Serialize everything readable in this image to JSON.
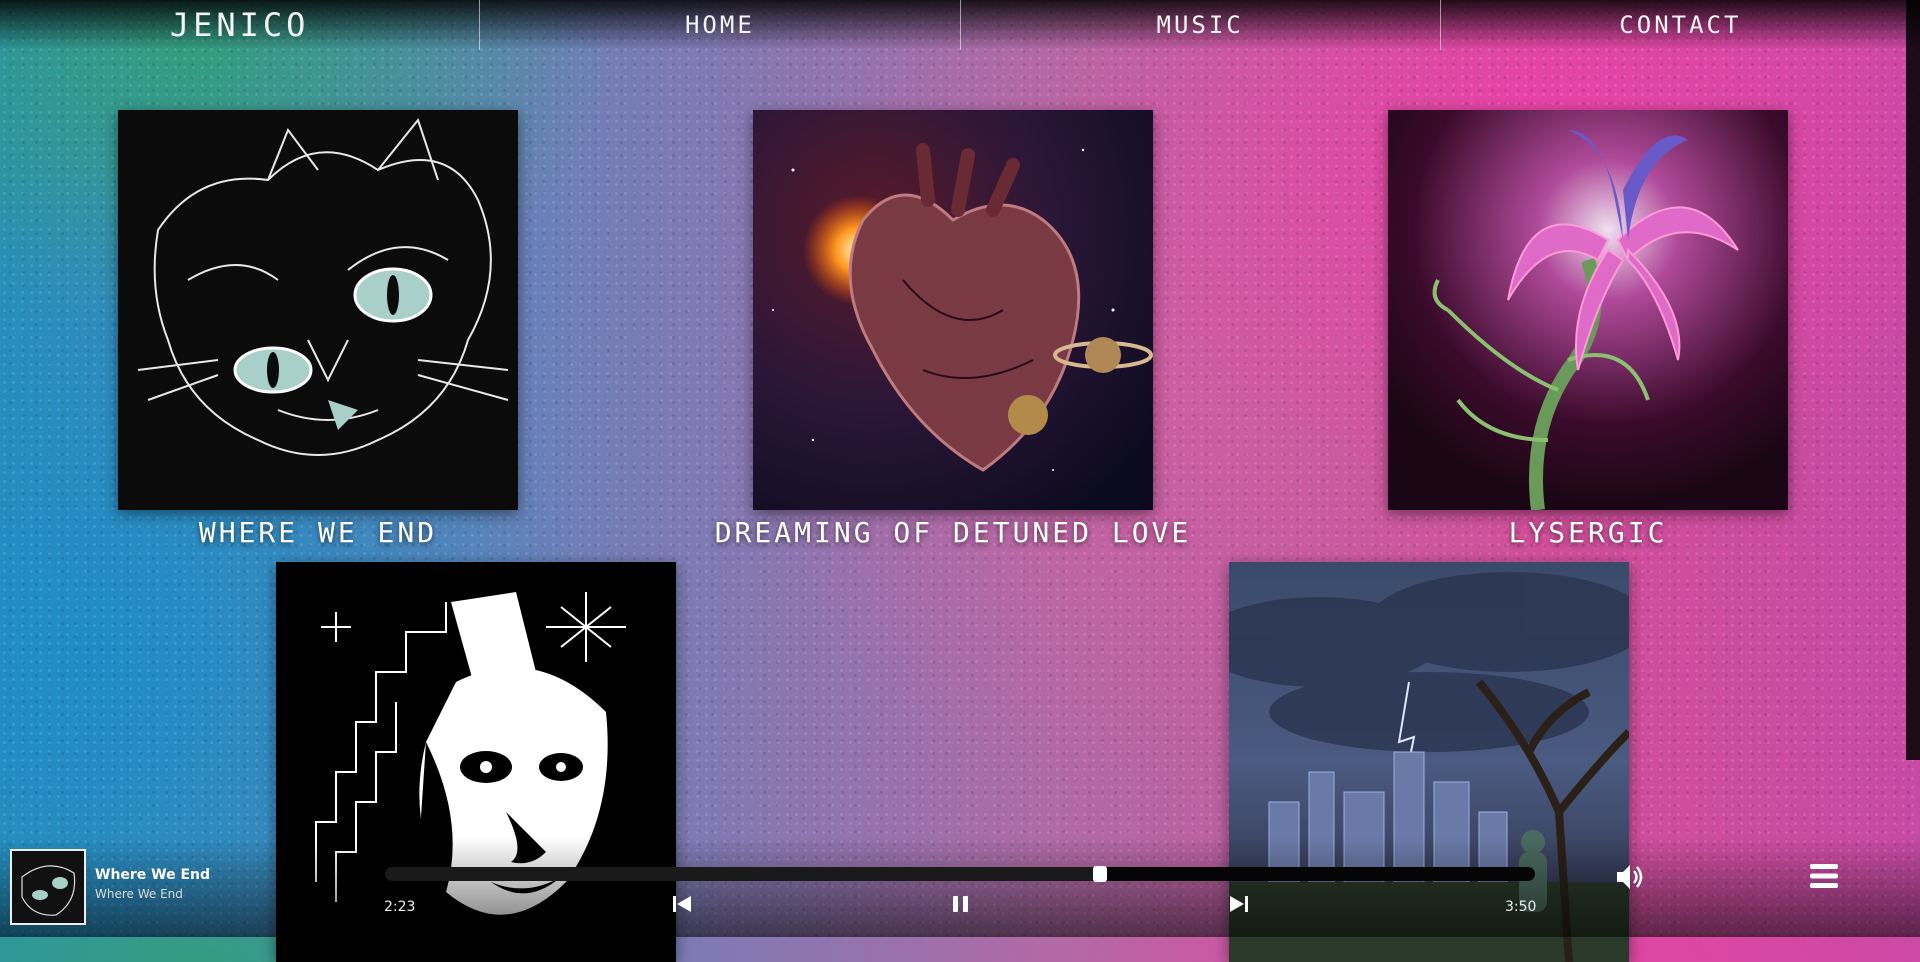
{
  "nav": {
    "brand": "JENICO",
    "items": [
      "HOME",
      "MUSIC",
      "CONTACT"
    ]
  },
  "albums": [
    {
      "title": "WHERE WE END"
    },
    {
      "title": "DREAMING OF DETUNED LOVE"
    },
    {
      "title": "LYSERGIC"
    },
    {
      "title": ""
    },
    {
      "title": ""
    }
  ],
  "player": {
    "track_title": "Where We End",
    "artist": "Where We End",
    "current_time": "2:23",
    "total_time": "3:50",
    "progress": 0.622
  },
  "colors": {
    "accent_pink": "#d24f9a",
    "accent_teal": "#2a8fb8"
  },
  "icons": [
    "previous-icon",
    "pause-icon",
    "next-icon",
    "volume-icon",
    "hamburger-menu-icon"
  ]
}
